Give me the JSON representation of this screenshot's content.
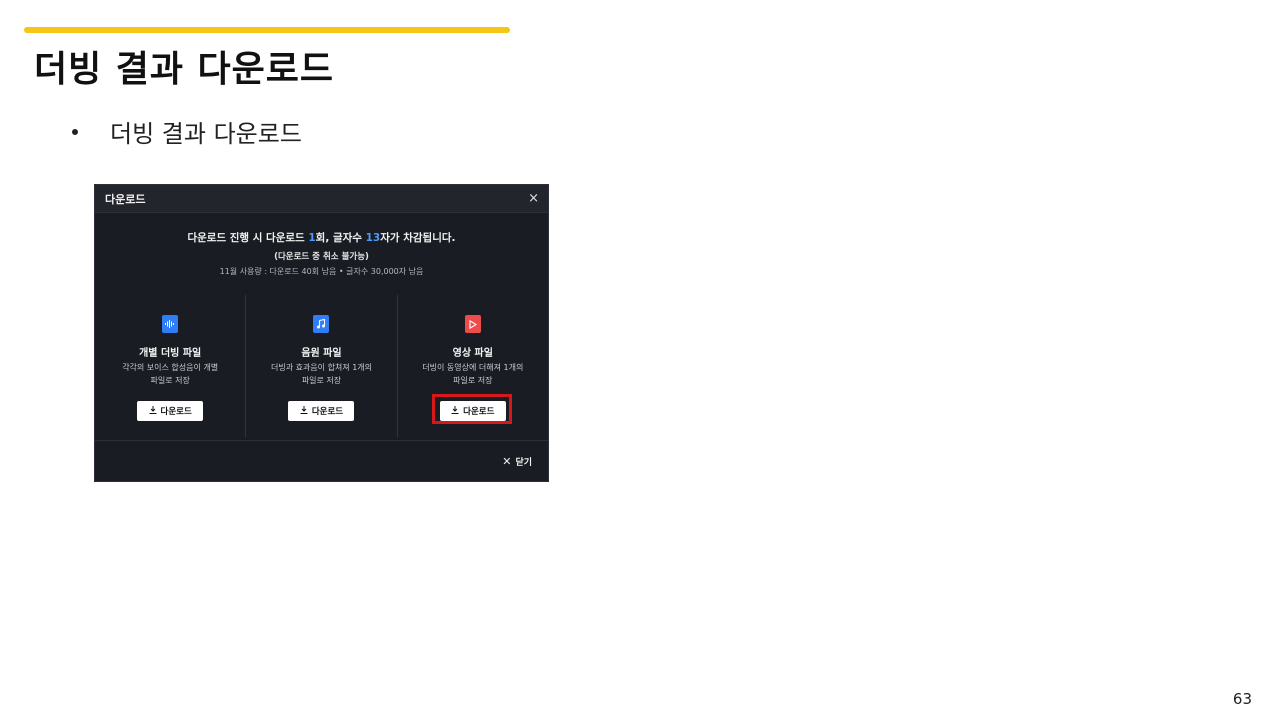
{
  "slide": {
    "title": "더빙 결과 다운로드",
    "bullet": "더빙 결과 다운로드",
    "page_number": "63",
    "accent_color": "#f5c518"
  },
  "dialog": {
    "title": "다운로드",
    "close_icon": "×",
    "notice": {
      "part1": "다운로드 진행 시 다운로드 ",
      "count": "1",
      "part2": "회, 글자수 ",
      "chars": "13",
      "part3": "자가 차감됩니다.",
      "sub": "(다운로드 중 취소 불가능)",
      "usage": "11월 사용량 : 다운로드 40회 남음 • 글자수 30,000자 남음"
    },
    "options": [
      {
        "icon": "audio-wave-icon",
        "title": "개별 더빙 파일",
        "desc_line1": "각각의 보이스 합성음이 개별",
        "desc_line2": "파일로 저장",
        "button": "다운로드"
      },
      {
        "icon": "music-note-icon",
        "title": "음원 파일",
        "desc_line1": "더빙과 효과음이 합쳐져 1개의",
        "desc_line2": "파일로 저장",
        "button": "다운로드"
      },
      {
        "icon": "video-play-icon",
        "title": "영상 파일",
        "desc_line1": "더빙이 동영상에 더해져 1개의",
        "desc_line2": "파일로 저장",
        "button": "다운로드"
      }
    ],
    "footer_close": "닫기",
    "highlight_color": "#d8171b",
    "accent_blue": "#4a9bff"
  }
}
